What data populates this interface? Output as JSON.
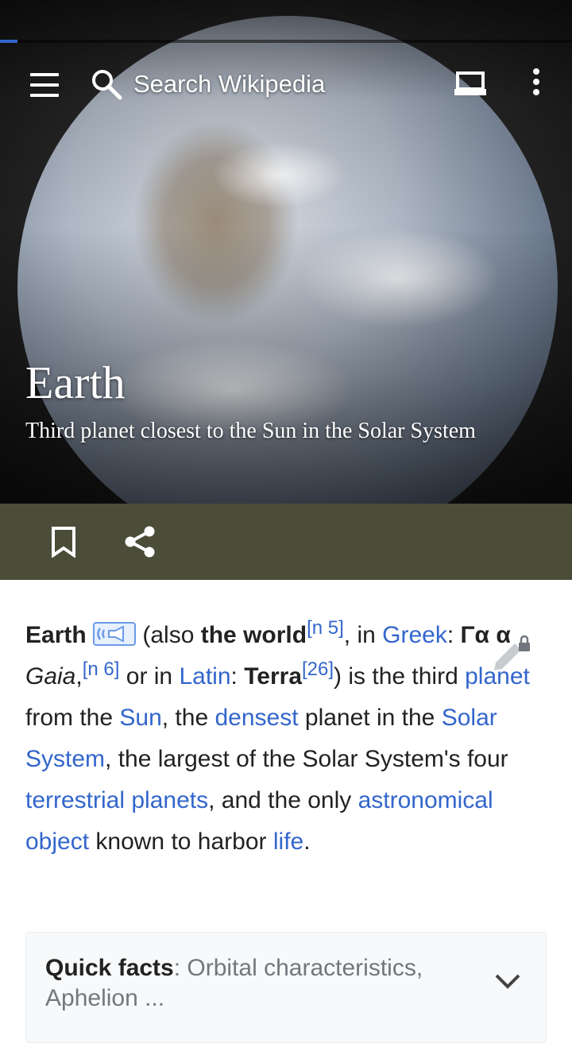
{
  "toolbar": {
    "search_placeholder": "Search Wikipedia",
    "page_load_progress": 0.03
  },
  "article": {
    "title": "Earth",
    "description": "Third planet closest to the Sun in the Solar System"
  },
  "body": {
    "p1": "Earth",
    "p2": " (also ",
    "p3": "the world",
    "p4": "[n 5]",
    "p5": ", in ",
    "p6": "Greek",
    "p7": ": ",
    "p8": "Γα α",
    "p9": " ",
    "p10": "Gaia",
    "p11": ",",
    "p12": "[n 6]",
    "p13": " or in ",
    "p14": "Latin",
    "p15": ": ",
    "p16": "Terra",
    "p17": "[26]",
    "p18": ") is the third ",
    "p19": "planet",
    "p20": " from the ",
    "p21": "Sun",
    "p22": ", the ",
    "p23": "densest",
    "p24": " planet in the ",
    "p25": "Solar System",
    "p26": ", the largest of the Solar System's four ",
    "p27": "terrestrial planets",
    "p28": ", and the only ",
    "p29": "astronomical object",
    "p30": " known to harbor ",
    "p31": "life",
    "p32": "."
  },
  "quick_facts": {
    "label": "Quick facts",
    "sep": ": ",
    "summary": "Orbital characteristics, Aphelion ..."
  },
  "colors": {
    "link": "#3366cc",
    "action_bar": "#4b4d39",
    "progress": "#3366cc"
  }
}
